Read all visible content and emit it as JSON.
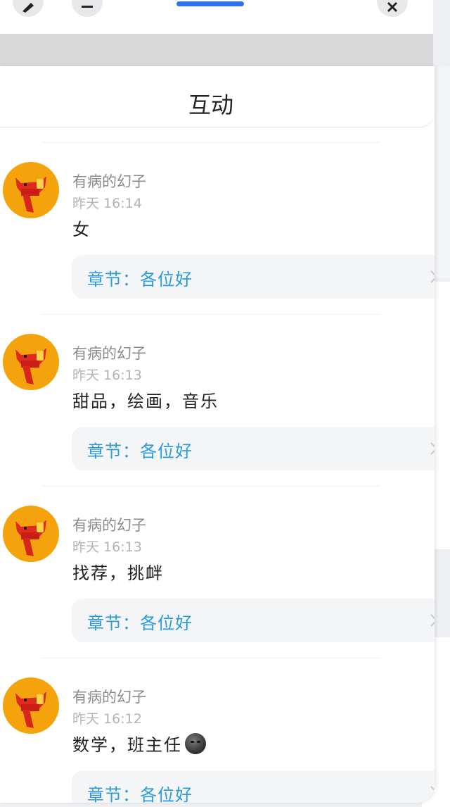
{
  "header": {
    "title": "互动"
  },
  "comments": [
    {
      "user": "有病的幻子",
      "time": "昨天 16:14",
      "text": "女",
      "emoji": false,
      "chapter": "章节：各位好"
    },
    {
      "user": "有病的幻子",
      "time": "昨天 16:13",
      "text": "甜品，绘画，音乐",
      "emoji": false,
      "chapter": "章节：各位好"
    },
    {
      "user": "有病的幻子",
      "time": "昨天 16:13",
      "text": "找荐，挑衅",
      "emoji": false,
      "chapter": "章节：各位好"
    },
    {
      "user": "有病的幻子",
      "time": "昨天 16:12",
      "text": "数学，班主任",
      "emoji": true,
      "chapter": "章节：各位好"
    }
  ],
  "colors": {
    "accent": "#2f6ff0",
    "chapter_text": "#2a9bd8",
    "avatar_bg": "#f4a30c"
  },
  "icons": [
    "edit-icon",
    "minimize-icon",
    "close-icon",
    "chevron-right-icon",
    "emoji-icon"
  ]
}
